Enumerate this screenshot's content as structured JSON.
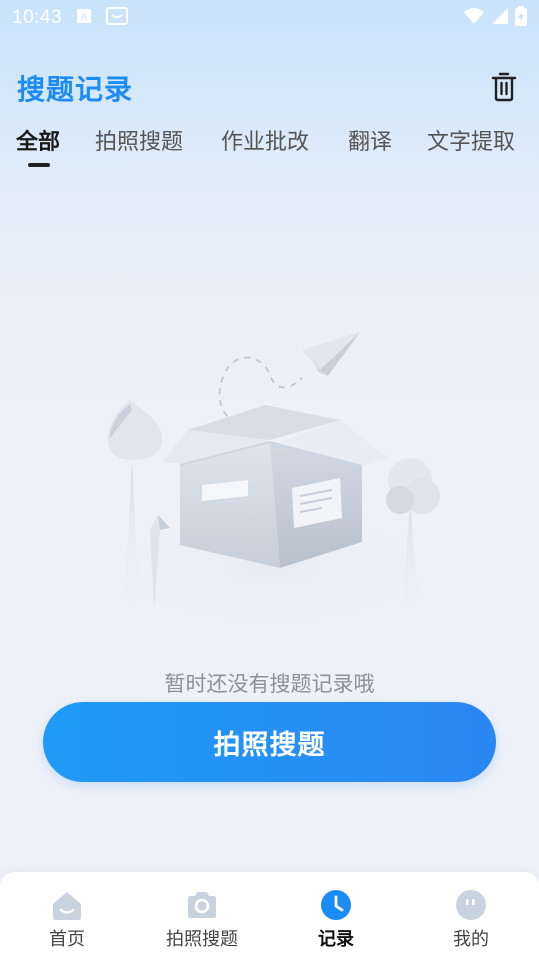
{
  "status_bar": {
    "time": "10:43"
  },
  "header": {
    "title": "搜题记录"
  },
  "tabs": [
    {
      "label": "全部",
      "active": true
    },
    {
      "label": "拍照搜题",
      "active": false
    },
    {
      "label": "作业批改",
      "active": false
    },
    {
      "label": "翻译",
      "active": false
    },
    {
      "label": "文字提取",
      "active": false
    }
  ],
  "empty_state": {
    "message": "暂时还没有搜题记录哦"
  },
  "primary_action": {
    "label": "拍照搜题"
  },
  "bottom_nav": [
    {
      "label": "首页",
      "icon": "home-icon",
      "active": false
    },
    {
      "label": "拍照搜题",
      "icon": "camera-icon",
      "active": false
    },
    {
      "label": "记录",
      "icon": "clock-icon",
      "active": true
    },
    {
      "label": "我的",
      "icon": "profile-icon",
      "active": false
    }
  ],
  "colors": {
    "accent": "#1b8cf5",
    "button_start": "#1f9bf7",
    "button_end": "#2a86f2",
    "nav_icon_inactive": "#c9d3df"
  }
}
